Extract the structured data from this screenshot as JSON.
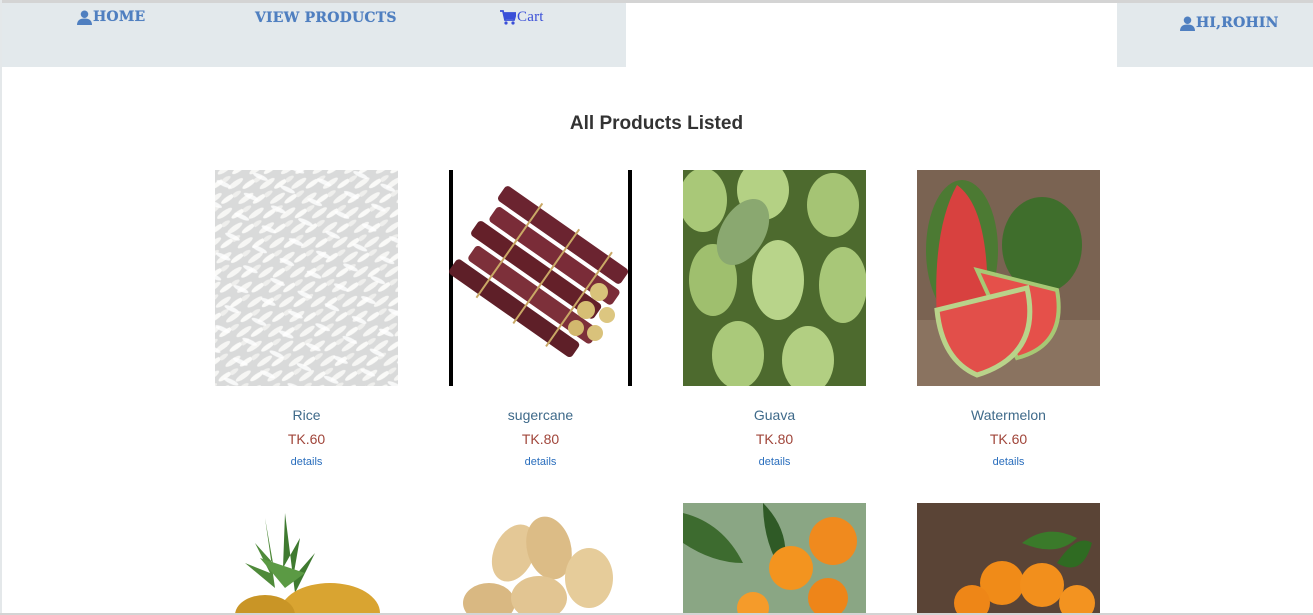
{
  "nav": {
    "home_label": "HOME",
    "products_label": "VIEW PRODUCTS",
    "cart_label": "Cart",
    "user_label": "HI,ROHIN"
  },
  "heading": "All Products Listed",
  "products": [
    {
      "name": "Rice",
      "price": "TK.60",
      "details": "details",
      "image": "rice-image"
    },
    {
      "name": "sugercane",
      "price": "TK.80",
      "details": "details",
      "image": "sugarcane-image"
    },
    {
      "name": "Guava",
      "price": "TK.80",
      "details": "details",
      "image": "guava-image"
    },
    {
      "name": "Watermelon",
      "price": "TK.60",
      "details": "details",
      "image": "watermelon-image"
    },
    {
      "image": "pineapple-image"
    },
    {
      "image": "peanut-image"
    },
    {
      "image": "orange-tree-image"
    },
    {
      "image": "orange-image"
    }
  ],
  "icons": {
    "home": "user-icon",
    "cart": "cart-icon",
    "user": "user-icon"
  },
  "colors": {
    "nav_bg": "#e3e9ec",
    "nav_text": "#4f7fc0",
    "cart_text": "#3a4fd8",
    "product_name": "#3f6a8a",
    "price": "#a0453a",
    "link": "#2a6ebd"
  }
}
